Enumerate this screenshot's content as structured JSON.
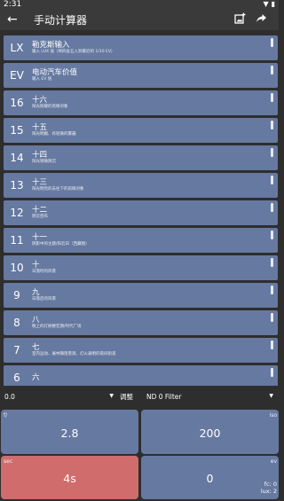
{
  "status": {
    "time": "2:31"
  },
  "app_bar": {
    "title": "手动计算器"
  },
  "rows": [
    {
      "ev": "LX",
      "main": "勒克斯输入",
      "sub": "输入 LUX 值（将四舍五入到最近的 1/10 EV）"
    },
    {
      "ev": "EV",
      "main": "电动汽车价值",
      "sub": "输入 EV 值"
    },
    {
      "ev": "16",
      "main": "十六",
      "sub": "阳光照耀的亮眼对象"
    },
    {
      "ev": "15",
      "main": "十五",
      "sub": "阳光明媚、有轻微的雾霾"
    },
    {
      "ev": "14",
      "main": "十四",
      "sub": "阳光稍微阴沉"
    },
    {
      "ev": "13",
      "main": "十三",
      "sub": "阳光明亮的去往下的前眼对象"
    },
    {
      "ev": "12",
      "main": "十二",
      "sub": "阴云密布"
    },
    {
      "ev": "11",
      "main": "十一",
      "sub": "阴影中的主题/阳云日（西藏图）"
    },
    {
      "ev": "10",
      "main": "十",
      "sub": "日落时的风景"
    },
    {
      "ev": "9",
      "main": "九",
      "sub": "日落后的风景"
    },
    {
      "ev": "8",
      "main": "八",
      "sub": "晚上的灯刷楼宏期/时代广场"
    },
    {
      "ev": "7",
      "main": "七",
      "sub": "室内运动、展林镇阻景观、灯火通明的夜间街道"
    },
    {
      "ev": "6",
      "main": "六",
      "sub": ""
    }
  ],
  "controls": {
    "left_value": "0.0",
    "adjust_label": "调整",
    "filter_value": "ND 0 Filter"
  },
  "panels": {
    "f": {
      "label": "f/",
      "value": "2.8"
    },
    "iso": {
      "label": "iso",
      "value": "200"
    },
    "sec": {
      "label": "sec",
      "value": "4s"
    },
    "ev": {
      "label": "ev",
      "value": "0",
      "fc": "fc: 0",
      "lux": "lux: 2"
    }
  },
  "colors": {
    "row_bg": "#6679a0",
    "sec_bg": "#d06c6c",
    "bg": "#2e2e2e"
  }
}
